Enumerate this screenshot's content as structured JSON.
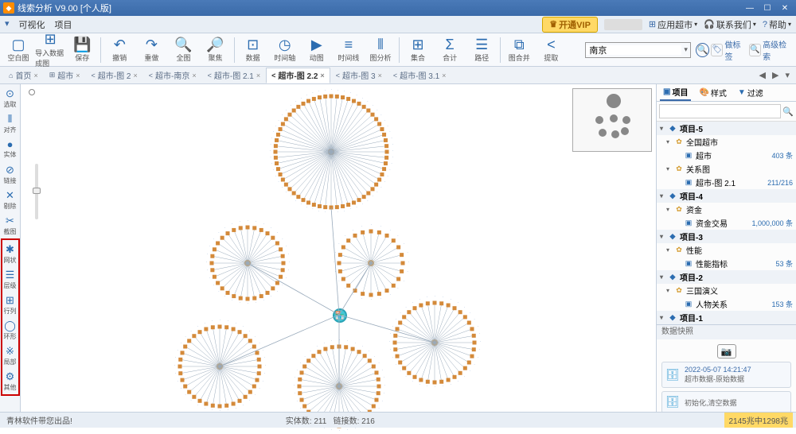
{
  "title": "线索分析 V9.00 [个人版]",
  "header": {
    "menu": [
      "可视化",
      "项目"
    ],
    "vip": "开通VIP",
    "links": [
      "应用超市",
      "联系我们",
      "帮助"
    ]
  },
  "toolbar": {
    "groups": [
      [
        {
          "g": "▢",
          "l": "空白图"
        },
        {
          "g": "⊞",
          "l": "导入数据成图"
        },
        {
          "g": "💾",
          "l": "保存"
        }
      ],
      [
        {
          "g": "↶",
          "l": "撤销"
        },
        {
          "g": "↷",
          "l": "重做"
        },
        {
          "g": "🔍",
          "l": "全图"
        },
        {
          "g": "🔎",
          "l": "聚焦"
        }
      ],
      [
        {
          "g": "⊡",
          "l": "数据"
        },
        {
          "g": "◷",
          "l": "时间轴"
        },
        {
          "g": "▶",
          "l": "动图"
        },
        {
          "g": "≡",
          "l": "时间线"
        },
        {
          "g": "⫴",
          "l": "图分析"
        }
      ],
      [
        {
          "g": "⊞",
          "l": "集合"
        },
        {
          "g": "Σ",
          "l": "合计"
        },
        {
          "g": "☰",
          "l": "路径"
        }
      ],
      [
        {
          "g": "⧉",
          "l": "图合并"
        },
        {
          "g": "<",
          "l": "提取"
        }
      ]
    ],
    "search_value": "南京",
    "aux1": "做标签",
    "aux2": "高级检索"
  },
  "tabs": [
    {
      "icon": "⌂",
      "label": "首页",
      "active": false
    },
    {
      "icon": "⊞",
      "label": "超市",
      "active": false
    },
    {
      "icon": "<",
      "label": "超市-图 2",
      "active": false
    },
    {
      "icon": "<",
      "label": "超市-南京",
      "active": false
    },
    {
      "icon": "<",
      "label": "超市-图 2.1",
      "active": false
    },
    {
      "icon": "<",
      "label": "超市-图 2.2",
      "active": true
    },
    {
      "icon": "<",
      "label": "超市-图 3",
      "active": false
    },
    {
      "icon": "<",
      "label": "超市-图 3.1",
      "active": false
    }
  ],
  "sidebar_top": [
    {
      "g": "⊙",
      "t": "选取"
    },
    {
      "g": "⫴",
      "t": "对齐"
    },
    {
      "g": "●",
      "t": "实体"
    },
    {
      "g": "⊘",
      "t": "链接"
    },
    {
      "g": "✕",
      "t": "剔除"
    },
    {
      "g": "✂",
      "t": "截图"
    }
  ],
  "sidebar_layout": [
    {
      "g": "✱",
      "t": "网状"
    },
    {
      "g": "☰",
      "t": "层级"
    },
    {
      "g": "⊞",
      "t": "行列"
    },
    {
      "g": "◯",
      "t": "环形"
    },
    {
      "g": "※",
      "t": "局部"
    },
    {
      "g": "⚙",
      "t": "其他"
    }
  ],
  "right": {
    "tabs": [
      "项目",
      "样式",
      "过滤"
    ],
    "projects": [
      {
        "name": "项目-5",
        "children": [
          {
            "name": "全国超市",
            "icon": "folder",
            "children": [
              {
                "name": "超市",
                "icon": "data",
                "count": "403 条"
              }
            ]
          },
          {
            "name": "关系图",
            "icon": "folder",
            "children": [
              {
                "name": "超市-图 2.1",
                "icon": "data",
                "count": "211/216"
              }
            ]
          }
        ]
      },
      {
        "name": "项目-4",
        "children": [
          {
            "name": "资金",
            "icon": "folder",
            "children": [
              {
                "name": "资金交易",
                "icon": "data",
                "count": "1,000,000 条"
              }
            ]
          }
        ]
      },
      {
        "name": "项目-3",
        "children": [
          {
            "name": "性能",
            "icon": "folder",
            "children": [
              {
                "name": "性能指标",
                "icon": "data",
                "count": "53 条"
              }
            ]
          }
        ]
      },
      {
        "name": "项目-2",
        "children": [
          {
            "name": "三国演义",
            "icon": "folder",
            "children": [
              {
                "name": "人物关系",
                "icon": "data",
                "count": "153 条"
              }
            ]
          }
        ]
      },
      {
        "name": "项目-1",
        "children": []
      }
    ],
    "snap_header": "数据快照",
    "snaps": [
      {
        "time": "2022-05-07 14:21:47",
        "label": "超市数据-原始数据"
      },
      {
        "time": "",
        "label": "初始化,清空数据"
      }
    ]
  },
  "status": {
    "left": "青林软件带您出品!",
    "center_entities": "实体数: 211",
    "center_links": "链接数: 216",
    "mem": "2145兆中1298兆"
  }
}
